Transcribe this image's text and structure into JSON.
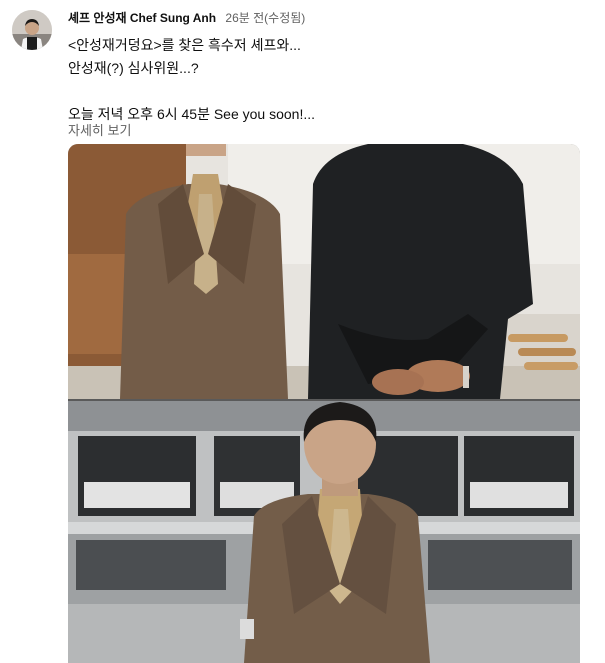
{
  "author": {
    "name": "셰프 안성재 Chef Sung Anh"
  },
  "timestamp": "26분 전(수정됨)",
  "content": {
    "lines": [
      "<안성재거덩요>를 찾은 흑수저 셰프와...",
      "안성재(?) 심사위원...?",
      "",
      "오늘 저녁 오후 6시 45분 See you soon!..."
    ]
  },
  "read_more": "자세히 보기",
  "icons": {
    "avatar": "chef-avatar-photo"
  },
  "colors": {
    "text": "#0f0f0f",
    "secondary": "#606060",
    "background": "#ffffff"
  }
}
